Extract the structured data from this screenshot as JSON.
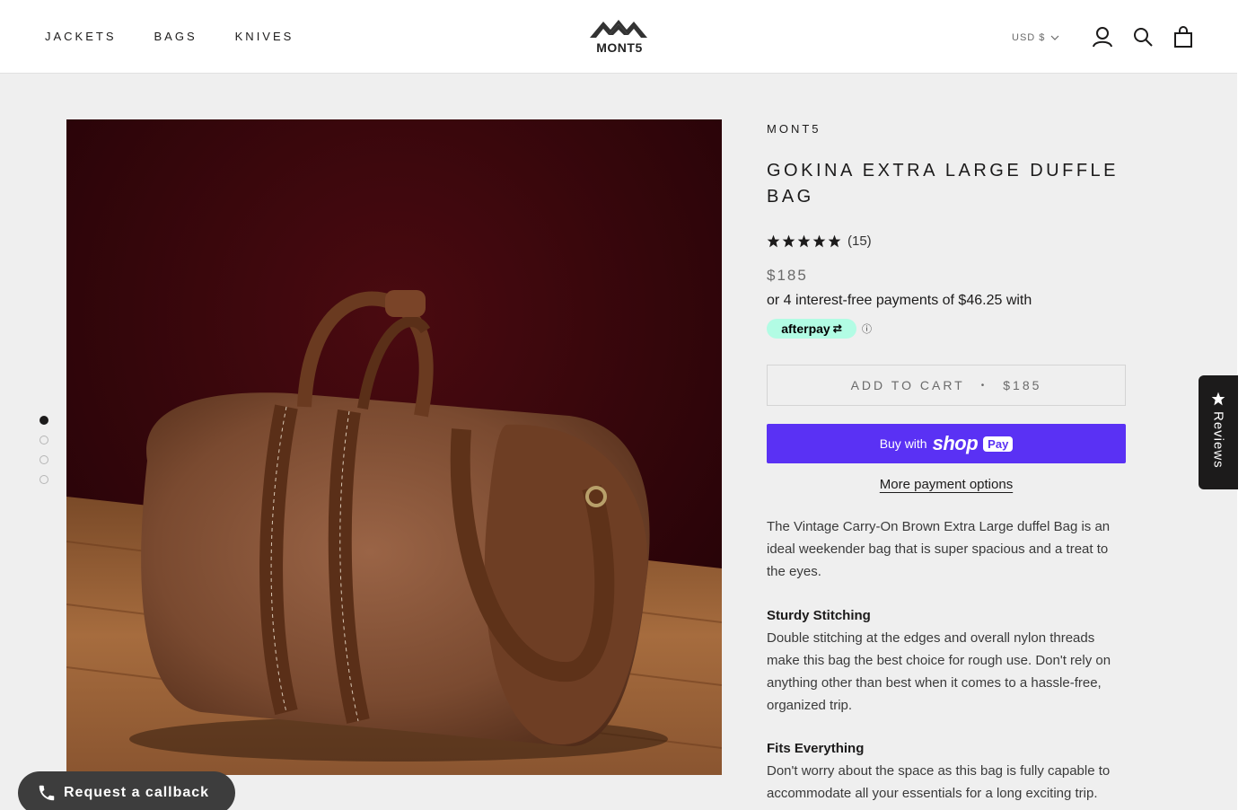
{
  "header": {
    "nav": [
      "JACKETS",
      "BAGS",
      "KNIVES"
    ],
    "logo_text": "MONT5",
    "currency": "USD $",
    "icons": [
      "account-icon",
      "search-icon",
      "cart-icon"
    ]
  },
  "gallery": {
    "dots": 4,
    "active_dot": 1,
    "image_alt": "brown-leather-duffle-bag"
  },
  "product": {
    "vendor": "MONT5",
    "title": "GOKINA EXTRA LARGE DUFFLE BAG",
    "rating": 5,
    "review_count": "(15)",
    "price": "$185",
    "afterpay_text": "or 4 interest-free payments of $46.25 with",
    "afterpay_logo": "afterpay",
    "afterpay_info": "ⓘ",
    "add_to_cart_label": "ADD TO CART",
    "add_to_cart_sep": "•",
    "add_to_cart_price": "$185",
    "shop_pay_buy": "Buy with",
    "shop_pay_shop": "shop",
    "shop_pay_pay": "Pay",
    "more_payment": "More payment options",
    "description_intro": "The Vintage Carry-On Brown Extra Large duffel Bag is an ideal weekender bag that is super spacious and a treat to the eyes.",
    "sections": [
      {
        "heading": "Sturdy Stitching",
        "body": "Double stitching at the edges and overall nylon threads make this bag the best choice for rough use. Don't rely on anything other than best when it comes to a hassle-free, organized trip."
      },
      {
        "heading": "Fits Everything",
        "body": "Don't worry about the space as this bag is fully capable to accommodate all your essentials for a long exciting trip. Multiple compartments are offered to keep your stuff"
      }
    ]
  },
  "reviews_tab": {
    "label": "Reviews"
  },
  "callback": {
    "label": "Request a callback"
  },
  "colors": {
    "accent_shop_pay": "#5a31f4",
    "afterpay": "#b2fce4",
    "background": "#efefef",
    "text": "#1c1b1b"
  }
}
